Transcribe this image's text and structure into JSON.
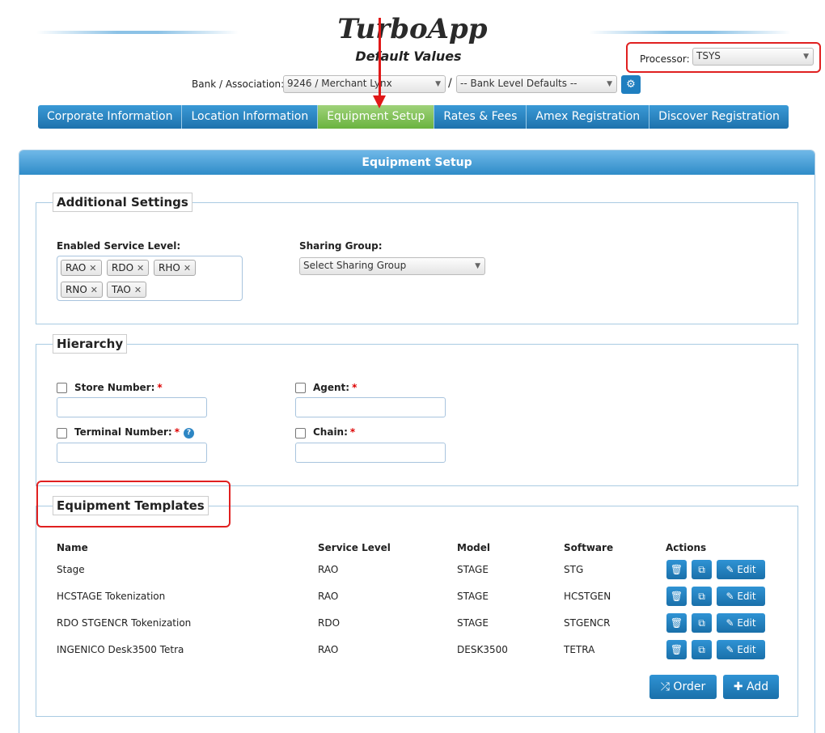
{
  "header": {
    "title": "TurboApp",
    "subtitle": "Default Values",
    "processor_label": "Processor:",
    "processor_value": "TSYS"
  },
  "bank": {
    "label": "Bank / Association:",
    "association_value": "9246 / Merchant Lynx",
    "separator": "/",
    "level_value": "-- Bank Level Defaults --"
  },
  "tabs": [
    {
      "label": "Corporate Information"
    },
    {
      "label": "Location Information"
    },
    {
      "label": "Equipment Setup"
    },
    {
      "label": "Rates & Fees"
    },
    {
      "label": "Amex Registration"
    },
    {
      "label": "Discover Registration"
    }
  ],
  "panel": {
    "title": "Equipment Setup"
  },
  "additional_settings": {
    "legend": "Additional Settings",
    "service_level_label": "Enabled Service Level:",
    "tags": [
      "RAO",
      "RDO",
      "RHO",
      "RNO",
      "TAO"
    ],
    "sharing_group_label": "Sharing Group:",
    "sharing_group_value": "Select Sharing Group"
  },
  "hierarchy": {
    "legend": "Hierarchy",
    "store_number_label": "Store Number:",
    "agent_label": "Agent:",
    "terminal_number_label": "Terminal Number:",
    "chain_label": "Chain:",
    "required_mark": "*"
  },
  "templates": {
    "legend": "Equipment Templates",
    "columns": [
      "Name",
      "Service Level",
      "Model",
      "Software",
      "Actions"
    ],
    "rows": [
      {
        "name": "Stage",
        "service_level": "RAO",
        "model": "STAGE",
        "software": "STG"
      },
      {
        "name": "HCSTAGE Tokenization",
        "service_level": "RAO",
        "model": "STAGE",
        "software": "HCSTGEN"
      },
      {
        "name": "RDO STGENCR Tokenization",
        "service_level": "RDO",
        "model": "STAGE",
        "software": "STGENCR"
      },
      {
        "name": "INGENICO Desk3500 Tetra",
        "service_level": "RAO",
        "model": "DESK3500",
        "software": "TETRA"
      }
    ],
    "edit_label": "Edit",
    "order_label": "Order",
    "add_label": "Add"
  },
  "colors": {
    "tab_blue": "#1e72ad",
    "tab_active_green": "#6ab33f",
    "highlight_red": "#e02020"
  }
}
